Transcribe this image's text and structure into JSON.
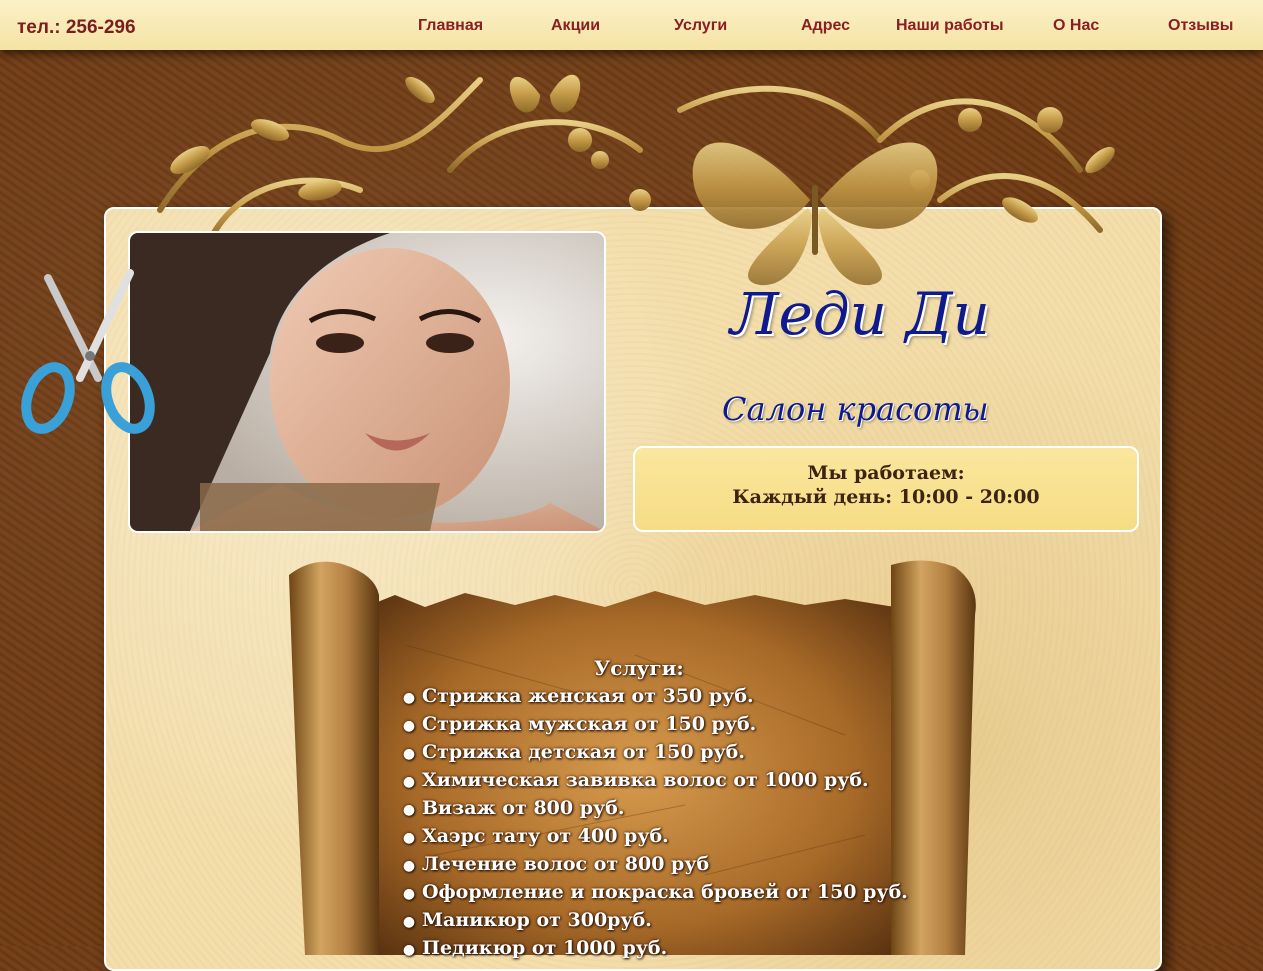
{
  "header": {
    "phone": "тел.: 256-296",
    "nav": [
      {
        "label": "Главная"
      },
      {
        "label": "Акции"
      },
      {
        "label": "Услуги"
      },
      {
        "label": "Адрес"
      },
      {
        "label": "Наши работы"
      },
      {
        "label": "О Нас"
      },
      {
        "label": "Отзывы"
      }
    ]
  },
  "brand": {
    "title": "Леди Ди",
    "subtitle": "Салон красоты"
  },
  "hours": {
    "line1": "Мы работаем:",
    "line2": "Каждый день: 10:00 - 20:00"
  },
  "services": {
    "title": "Услуги:",
    "items": [
      "Стрижка женская от 350 руб.",
      "Стрижка мужская от 150 руб.",
      "Стрижка детская от 150 руб.",
      "Химическая завивка волос от 1000 руб.",
      "Визаж от 800 руб.",
      "Хаэрс тату от 400 руб.",
      "Лечение волос от 800 руб",
      "Оформление и покраска бровей от 150 руб.",
      "Маникюр от 300руб.",
      "Педикюр от 1000 руб."
    ]
  },
  "colors": {
    "nav_text": "#8a1e22",
    "brand_blue": "#0f1a8c",
    "background_brown": "#6e3a12",
    "parchment": "#f3deac",
    "hours_box": "#f6dc84"
  }
}
